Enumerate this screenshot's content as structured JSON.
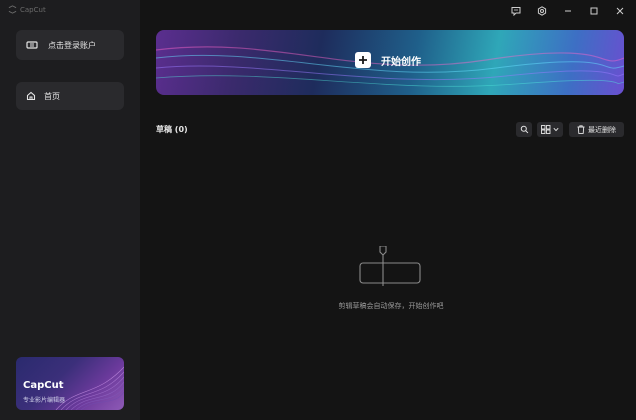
{
  "app": {
    "title": "CapCut"
  },
  "sidebar": {
    "login_label": "点击登录账户",
    "home_label": "首页",
    "promo": {
      "brand": "CapCut",
      "tagline": "专业影片编辑器"
    }
  },
  "banner": {
    "cta_label": "开始创作"
  },
  "drafts": {
    "title": "草稿 (0)",
    "recycle_label": "最近删除",
    "empty_text": "剪辑草稿会自动保存，开始创作吧"
  },
  "icons": {
    "window": [
      "feedback-icon",
      "settings-icon",
      "minimize-icon",
      "maximize-icon",
      "close-icon"
    ]
  },
  "colors": {
    "background": "#141414",
    "sidebar": "#1d1d1f",
    "button": "#2a2a2d"
  }
}
